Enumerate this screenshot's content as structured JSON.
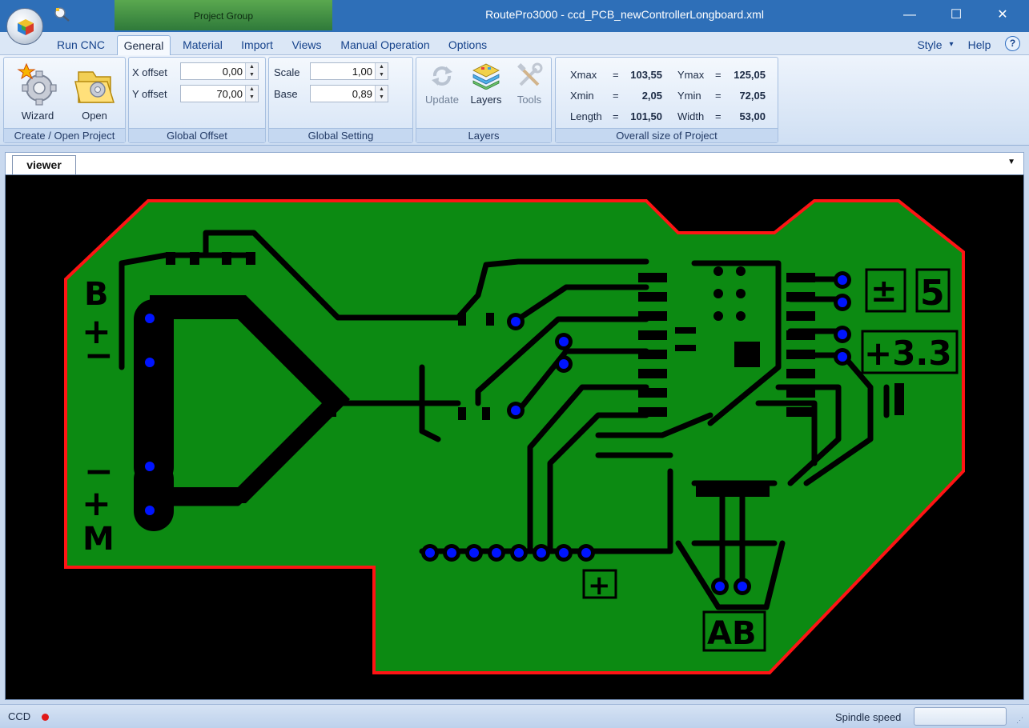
{
  "titlebar": {
    "project_group": "Project Group",
    "title": "RoutePro3000 - ccd_PCB_newControllerLongboard.xml",
    "minimize": "—",
    "maximize": "☐",
    "close": "✕"
  },
  "menu": {
    "tabs": [
      "Run CNC",
      "General",
      "Material",
      "Import",
      "Views",
      "Manual Operation",
      "Options"
    ],
    "active_tab": "General",
    "style": "Style",
    "style_arrow": "▾",
    "help": "Help",
    "help_icon": "?"
  },
  "ribbon": {
    "create_open": {
      "label": "Create / Open Project",
      "wizard": "Wizard",
      "open": "Open"
    },
    "global_offset": {
      "label": "Global Offset",
      "x_label": "X offset",
      "x_value": "0,00",
      "y_label": "Y offset",
      "y_value": "70,00"
    },
    "global_setting": {
      "label": "Global Setting",
      "scale_label": "Scale",
      "scale_value": "1,00",
      "base_label": "Base",
      "base_value": "0,89"
    },
    "layers": {
      "label": "Layers",
      "update": "Update",
      "layers": "Layers",
      "tools": "Tools"
    },
    "overall_size": {
      "label": "Overall size of Project",
      "xmax_label": "Xmax",
      "xmax_eq": "=",
      "xmax": "103,55",
      "ymax_label": "Ymax",
      "ymax_eq": "=",
      "ymax": "125,05",
      "xmin_label": "Xmin",
      "xmin_eq": "=",
      "xmin": "2,05",
      "ymin_label": "Ymin",
      "ymin_eq": "=",
      "ymin": "72,05",
      "length_label": "Length",
      "length_eq": "=",
      "length": "101,50",
      "width_label": "Width",
      "width_eq": "=",
      "width": "53,00"
    }
  },
  "viewer": {
    "tab": "viewer",
    "dropdown": "▼",
    "board_labels": {
      "b": "B",
      "plus_left": "+",
      "minus_left": "−",
      "minus_left2": "−",
      "plus_left2": "+",
      "m": "M",
      "pm": "±",
      "five": "5",
      "three_three": "+3.3",
      "plus_bottom": "+",
      "ab": "AB"
    },
    "colors": {
      "background": "#000000",
      "copper": "#0c8a12",
      "outline": "#ff1414",
      "via": "#0014ff",
      "trace": "#000000"
    }
  },
  "statusbar": {
    "ccd": "CCD",
    "ccd_dot_color": "#e01818",
    "spindle_label": "Spindle speed",
    "spindle_value": ""
  }
}
